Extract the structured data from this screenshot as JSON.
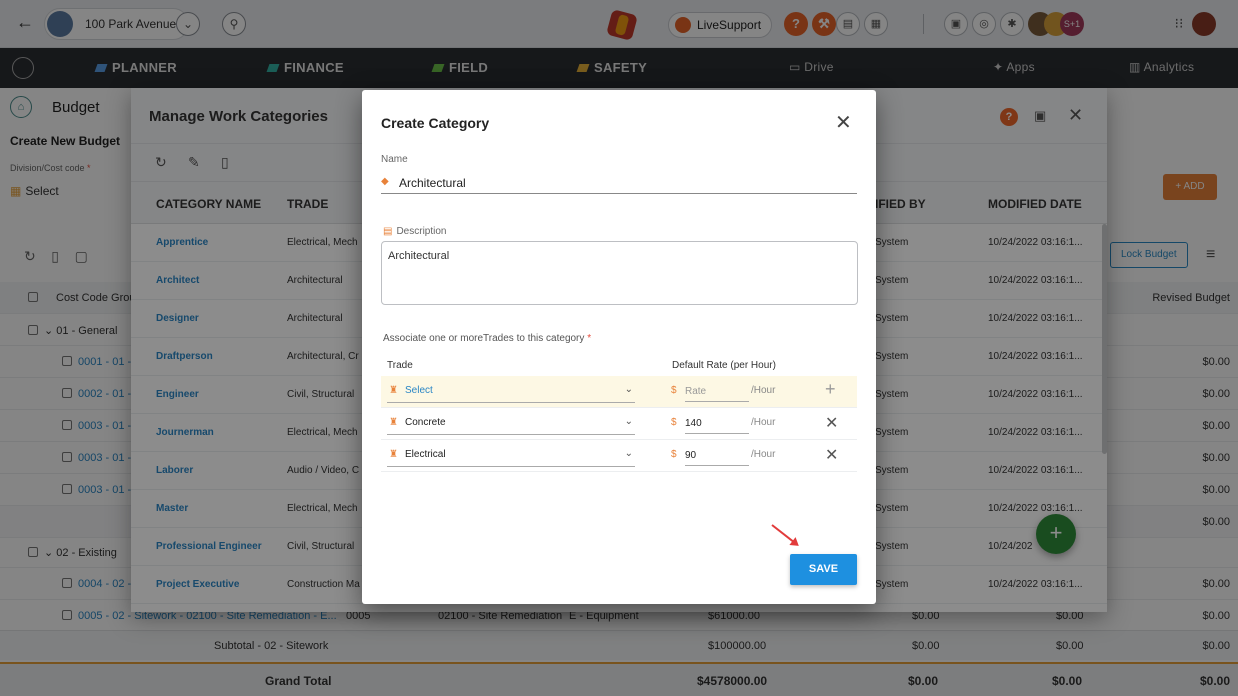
{
  "topbar": {
    "project_name": "100 Park Avenue",
    "live_support": "LiveSupport",
    "user_badge": "S+1"
  },
  "nav": {
    "items": [
      "PLANNER",
      "FINANCE",
      "FIELD",
      "SAFETY",
      "Drive",
      "Apps",
      "Analytics"
    ]
  },
  "page": {
    "title": "Budget",
    "create_new": "Create New Budget",
    "division_label": "Division/Cost code",
    "division_value": "Select",
    "add_label": "+ ADD",
    "lock_budget": "Lock Budget",
    "col_group": "Cost Code Group",
    "col_revised": "Revised Budget",
    "groups": [
      {
        "label": "01 - General"
      },
      {
        "label": "02 - Existing"
      }
    ],
    "rows": [
      {
        "code": "0001 - 01 -",
        "value": "$0.00"
      },
      {
        "code": "0002 - 01 -",
        "value": "$0.00"
      },
      {
        "code": "0003 - 01 -",
        "value": "$0.00"
      },
      {
        "code": "0003 - 01 -",
        "value": "$0.00"
      },
      {
        "code": "0003 - 01 -",
        "value": "$0.00"
      },
      {
        "code": "0004 - 02 -",
        "value": "$0.00"
      }
    ],
    "subtotal_general_value": "$0.00",
    "partial_row": {
      "code": "0005 - 02 - Sitework - 02100 - Site Remediation - E...",
      "c2": "0005",
      "c3": "02100 - Site Remediation",
      "c4": "E - Equipment",
      "c5": "$61000.00",
      "c6": "$0.00",
      "c7": "$0.00",
      "c8": "$0.00"
    },
    "subtotal": {
      "label": "Subtotal - 02 - Sitework",
      "v1": "$100000.00",
      "v2": "$0.00",
      "v3": "$0.00",
      "v4": "$0.00"
    },
    "grand": {
      "label": "Grand Total",
      "v1": "$4578000.00",
      "v2": "$0.00",
      "v3": "$0.00",
      "v4": "$0.00"
    }
  },
  "manage": {
    "title": "Manage Work Categories",
    "headers": {
      "category": "CATEGORY NAME",
      "trade": "TRADE",
      "modified_by": "MODIFIED BY",
      "modified_by_visible": "IFIED BY",
      "modified_date": "MODIFIED DATE"
    },
    "rows": [
      {
        "name": "Apprentice",
        "trade": "Electrical, Mech",
        "by": "System",
        "date": "10/24/2022 03:16:1..."
      },
      {
        "name": "Architect",
        "trade": "Architectural",
        "by": "System",
        "date": "10/24/2022 03:16:1..."
      },
      {
        "name": "Designer",
        "trade": "Architectural",
        "by": "System",
        "date": "10/24/2022 03:16:1..."
      },
      {
        "name": "Draftperson",
        "trade": "Architectural, Cr",
        "by": "System",
        "date": "10/24/2022 03:16:1..."
      },
      {
        "name": "Engineer",
        "trade": "Civil, Structural",
        "by": "System",
        "date": "10/24/2022 03:16:1..."
      },
      {
        "name": "Journerman",
        "trade": "Electrical, Mech",
        "by": "System",
        "date": "10/24/2022 03:16:1..."
      },
      {
        "name": "Laborer",
        "trade": "Audio / Video, C",
        "by": "System",
        "date": "10/24/2022 03:16:1..."
      },
      {
        "name": "Master",
        "trade": "Electrical, Mech",
        "by": "System",
        "date": "10/24/2022 03:16:1..."
      },
      {
        "name": "Professional Engineer",
        "trade": "Civil, Structural",
        "by": "System",
        "date": "10/24/202"
      },
      {
        "name": "Project Executive",
        "trade": "Construction Ma",
        "by": "System",
        "date": "10/24/2022 03:16:1..."
      }
    ]
  },
  "create": {
    "title": "Create Category",
    "name_label": "Name",
    "name_value": "Architectural",
    "desc_label": "Description",
    "desc_value": "Architectural",
    "assoc_label": "Associate one or moreTrades to this category",
    "th_trade": "Trade",
    "th_rate": "Default Rate (per Hour)",
    "per_hour": "/Hour",
    "rate_placeholder": "Rate",
    "trades": [
      {
        "name": "Select",
        "rate": ""
      },
      {
        "name": "Concrete",
        "rate": "140"
      },
      {
        "name": "Electrical",
        "rate": "90"
      }
    ],
    "save_label": "SAVE"
  },
  "colors": {
    "accent_orange": "#e8823a",
    "link_blue": "#2a86c5",
    "save_blue": "#1e90e0",
    "fab_green": "#2e8b3a",
    "navbar": "#2b2e33"
  }
}
